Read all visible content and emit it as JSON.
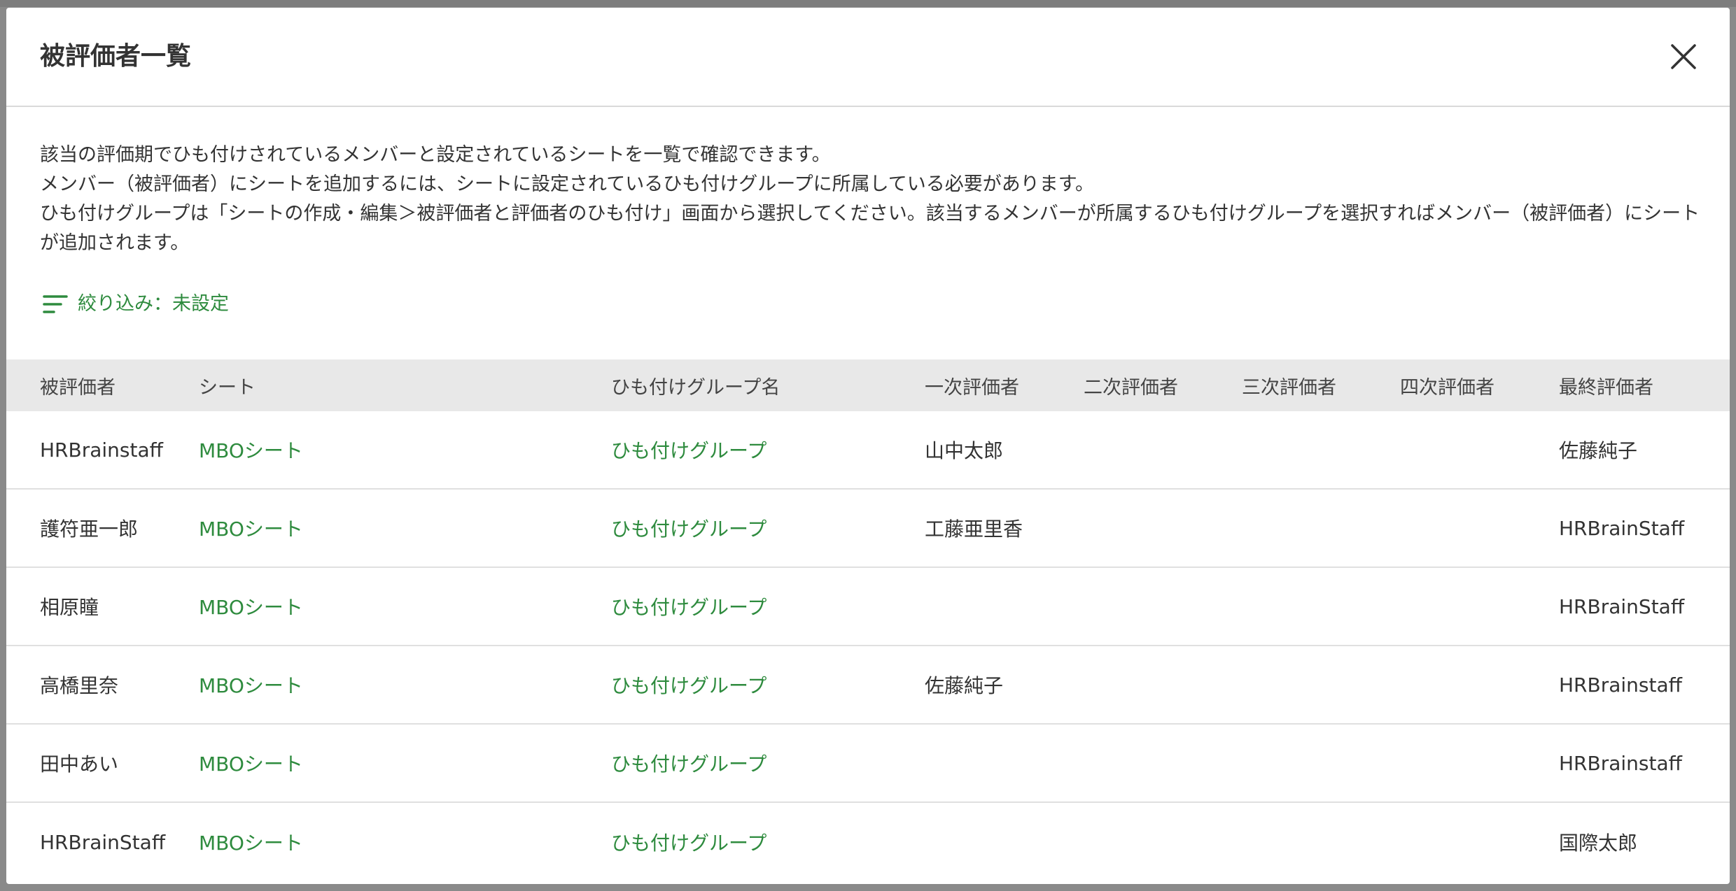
{
  "modal": {
    "title": "被評価者一覧",
    "description": [
      "該当の評価期でひも付けされているメンバーと設定されているシートを一覧で確認できます。",
      "メンバー（被評価者）にシートを追加するには、シートに設定されているひも付けグループに所属している必要があります。",
      "ひも付けグループは「シートの作成・編集＞被評価者と評価者のひも付け」画面から選択してください。該当するメンバーが所属するひも付けグループを選択すればメンバー（被評価者）にシートが追加されます。"
    ],
    "filter_label": "絞り込み：未設定",
    "close_icon": "close-icon",
    "filter_icon": "filter-lines-icon"
  },
  "colors": {
    "accent_green": "#2e8b3e",
    "header_bg": "#e8e8e8",
    "text": "#333333"
  },
  "table": {
    "columns": [
      "被評価者",
      "シート",
      "ひも付けグループ名",
      "一次評価者",
      "二次評価者",
      "三次評価者",
      "四次評価者",
      "最終評価者"
    ],
    "rows": [
      {
        "ratee": "HRBrainstaff",
        "sheet": "MBOシート",
        "group": "ひも付けグループ",
        "e1": "山中太郎",
        "e2": "",
        "e3": "",
        "e4": "",
        "final": "佐藤純子"
      },
      {
        "ratee": "護符亜一郎",
        "sheet": "MBOシート",
        "group": "ひも付けグループ",
        "e1": "工藤亜里香",
        "e2": "",
        "e3": "",
        "e4": "",
        "final": "HRBrainStaff"
      },
      {
        "ratee": "相原瞳",
        "sheet": "MBOシート",
        "group": "ひも付けグループ",
        "e1": "",
        "e2": "",
        "e3": "",
        "e4": "",
        "final": "HRBrainStaff"
      },
      {
        "ratee": "高橋里奈",
        "sheet": "MBOシート",
        "group": "ひも付けグループ",
        "e1": "佐藤純子",
        "e2": "",
        "e3": "",
        "e4": "",
        "final": "HRBrainstaff"
      },
      {
        "ratee": "田中あい",
        "sheet": "MBOシート",
        "group": "ひも付けグループ",
        "e1": "",
        "e2": "",
        "e3": "",
        "e4": "",
        "final": "HRBrainstaff"
      },
      {
        "ratee": "HRBrainStaff",
        "sheet": "MBOシート",
        "group": "ひも付けグループ",
        "e1": "",
        "e2": "",
        "e3": "",
        "e4": "",
        "final": "国際太郎"
      }
    ]
  }
}
